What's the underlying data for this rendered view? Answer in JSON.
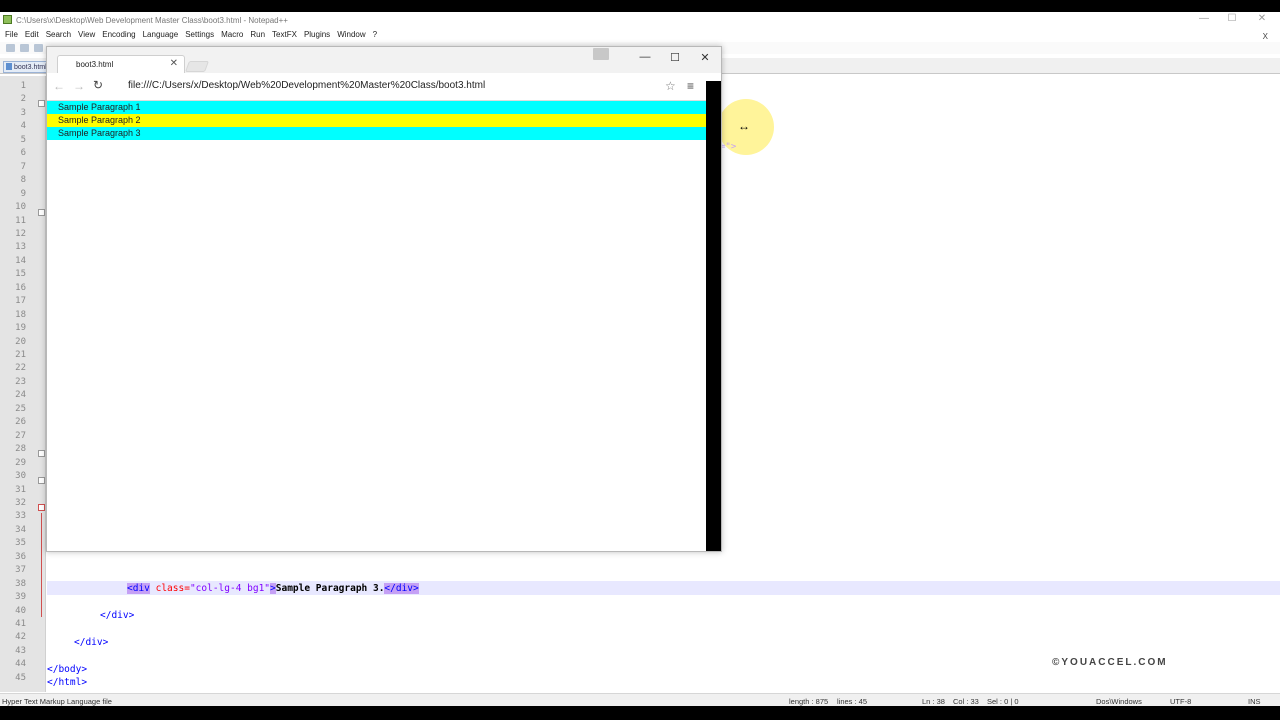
{
  "notepad": {
    "title": "C:\\Users\\x\\Desktop\\Web Development Master Class\\boot3.html - Notepad++",
    "menu": [
      "File",
      "Edit",
      "Search",
      "View",
      "Encoding",
      "Language",
      "Settings",
      "Macro",
      "Run",
      "TextFX",
      "Plugins",
      "Window",
      "?"
    ],
    "close_label": "X",
    "tab_label": "boot3.html",
    "line_numbers": [
      "1",
      "2",
      "3",
      "4",
      "5",
      "6",
      "7",
      "8",
      "9",
      "10",
      "11",
      "12",
      "13",
      "14",
      "15",
      "16",
      "17",
      "18",
      "19",
      "20",
      "21",
      "22",
      "23",
      "24",
      "25",
      "26",
      "27",
      "28",
      "29",
      "30",
      "31",
      "32",
      "33",
      "34",
      "35",
      "36",
      "37",
      "38",
      "39",
      "40",
      "41",
      "42",
      "43",
      "44",
      "45"
    ],
    "code": {
      "line38": {
        "open": "<div",
        "attr": " class=",
        "val": "\"col-lg-4 bg1\"",
        "gt": ">",
        "text": "Sample Paragraph 3.",
        "close": "</div>"
      },
      "line40": "</div>",
      "line42": "</div>",
      "line44": "</body>",
      "line45": "</html>"
    },
    "fragment_text": "=\">",
    "status": {
      "filetype": "Hyper Text Markup Language file",
      "length": "length : 875",
      "lines": "lines : 45",
      "position": "Ln : 38",
      "col": "Col : 33",
      "sel": "Sel : 0 | 0",
      "eol": "Dos\\Windows",
      "encoding": "UTF-8",
      "mode": "INS"
    }
  },
  "watermark": "©YOUACCEL.COM",
  "browser": {
    "tab_title": "boot3.html",
    "url": "file:///C:/Users/x/Desktop/Web%20Development%20Master%20Class/boot3.html",
    "paragraphs": [
      {
        "text": "Sample Paragraph 1",
        "color": "#00ffff"
      },
      {
        "text": "Sample Paragraph 2",
        "color": "#ffff00"
      },
      {
        "text": "Sample Paragraph 3",
        "color": "#00ffff"
      }
    ]
  },
  "icons": {
    "back": "←",
    "forward": "→",
    "reload": "↻",
    "star": "☆",
    "menu": "≡",
    "minimize": "—",
    "maximize": "☐",
    "close": "✕",
    "resize_cursor": "↔"
  }
}
